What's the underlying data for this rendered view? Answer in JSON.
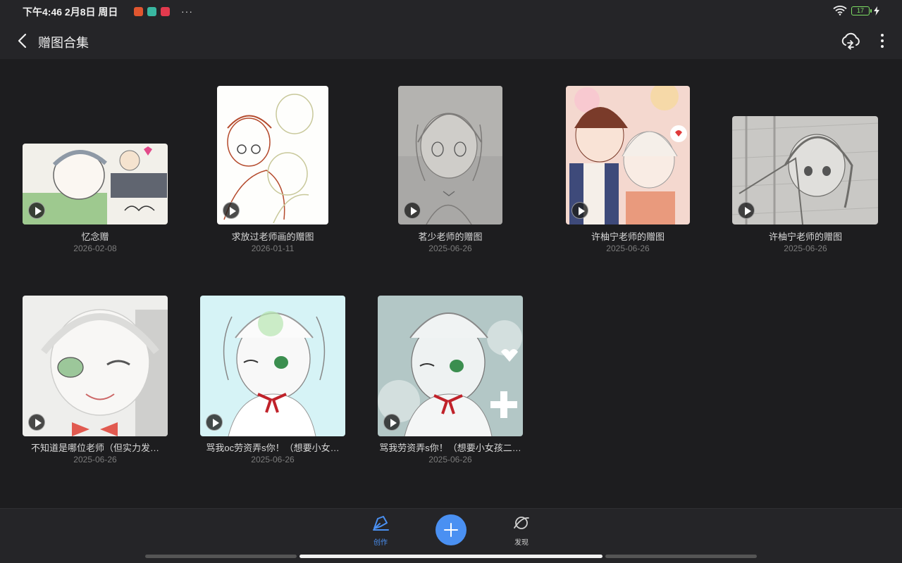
{
  "status": {
    "time": "下午4:46 2月8日 周日",
    "more": "···",
    "battery": "17",
    "app_colors": [
      "#e0562f",
      "#39b7a1",
      "#e23a4e"
    ]
  },
  "header": {
    "title": "赠图合集",
    "back_icon": "chevron-left-icon",
    "cloud_icon": "cloud-sync-icon",
    "more_icon": "more-vertical-icon"
  },
  "works": [
    {
      "title": "忆念赠",
      "date": "2026-02-08",
      "thumb_colors": [
        "#f2f0ea",
        "#9ec98f",
        "#606570"
      ]
    },
    {
      "title": "求放过老师画的赠图",
      "date": "2026-01-11",
      "thumb_colors": [
        "#fefefc",
        "#b44a2c",
        "#c8c89a"
      ]
    },
    {
      "title": "茗少老师的赠图",
      "date": "2025-06-26",
      "thumb_colors": [
        "#a9a8a6",
        "#7d7b79",
        "#cfcdc9"
      ]
    },
    {
      "title": "许柚宁老师的赠图",
      "date": "2025-06-26",
      "thumb_colors": [
        "#f4d8cf",
        "#7a3b2a",
        "#f5efe9"
      ]
    },
    {
      "title": "许柚宁老师的赠图",
      "date": "2025-06-26",
      "thumb_colors": [
        "#c9c8c5",
        "#6e6d6a",
        "#e0dfdc"
      ]
    },
    {
      "title": "不知道是哪位老师（但实力发…",
      "date": "2025-06-26",
      "thumb_colors": [
        "#eeeeec",
        "#9cc79a",
        "#e15a50"
      ]
    },
    {
      "title": "骂我oc劳资弄s你！（想要小女…",
      "date": "2025-06-26",
      "thumb_colors": [
        "#d6f3f6",
        "#f8f8f8",
        "#c0222a"
      ]
    },
    {
      "title": "骂我劳资弄s你！（想要小女孩二…",
      "date": "2025-06-26",
      "thumb_colors": [
        "#b3c7c6",
        "#e8eeee",
        "#c0222a"
      ]
    }
  ],
  "nav": {
    "create_label": "创作",
    "discover_label": "发现",
    "create_icon": "pen-nib-icon",
    "discover_icon": "planet-icon",
    "add_icon": "plus-icon",
    "accent": "#4a90f2"
  }
}
